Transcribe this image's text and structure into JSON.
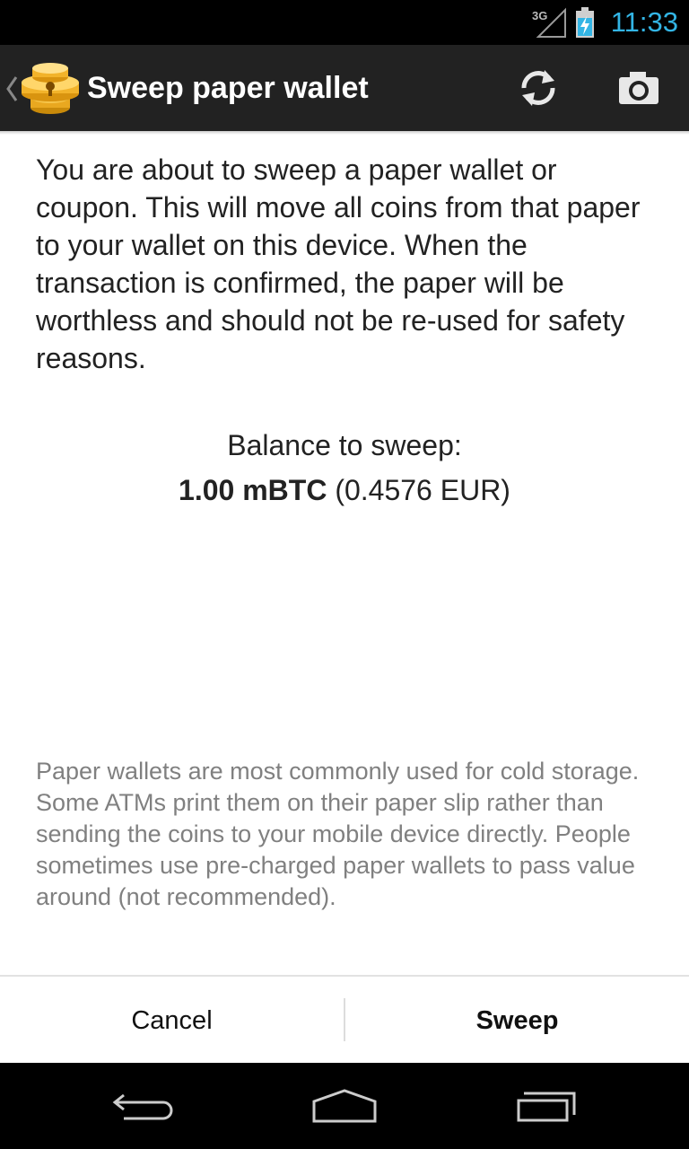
{
  "status_bar": {
    "network": "3G",
    "time": "11:33",
    "accent_color": "#33b5e5"
  },
  "action_bar": {
    "title": "Sweep paper wallet",
    "icons": [
      "back-chevron-icon",
      "app-logo-icon",
      "refresh-icon",
      "camera-icon"
    ]
  },
  "content": {
    "message": "You are about to sweep a paper wallet or coupon. This will move all coins from that paper to your wallet on this device. When the transaction is confirmed, the paper will be worthless and should not be re-used for safety reasons.",
    "balance_label": "Balance to sweep:",
    "balance_amount": "1.00 mBTC",
    "balance_fiat": "(0.4576 EUR)",
    "hint": "Paper wallets are most commonly used for cold storage. Some ATMs print them on their paper slip rather than sending the coins to your mobile device directly. People sometimes use pre-charged paper wallets to pass value around (not recommended)."
  },
  "buttons": {
    "cancel": "Cancel",
    "sweep": "Sweep"
  },
  "nav_bar": {
    "icons": [
      "back-icon",
      "home-icon",
      "recents-icon"
    ]
  }
}
